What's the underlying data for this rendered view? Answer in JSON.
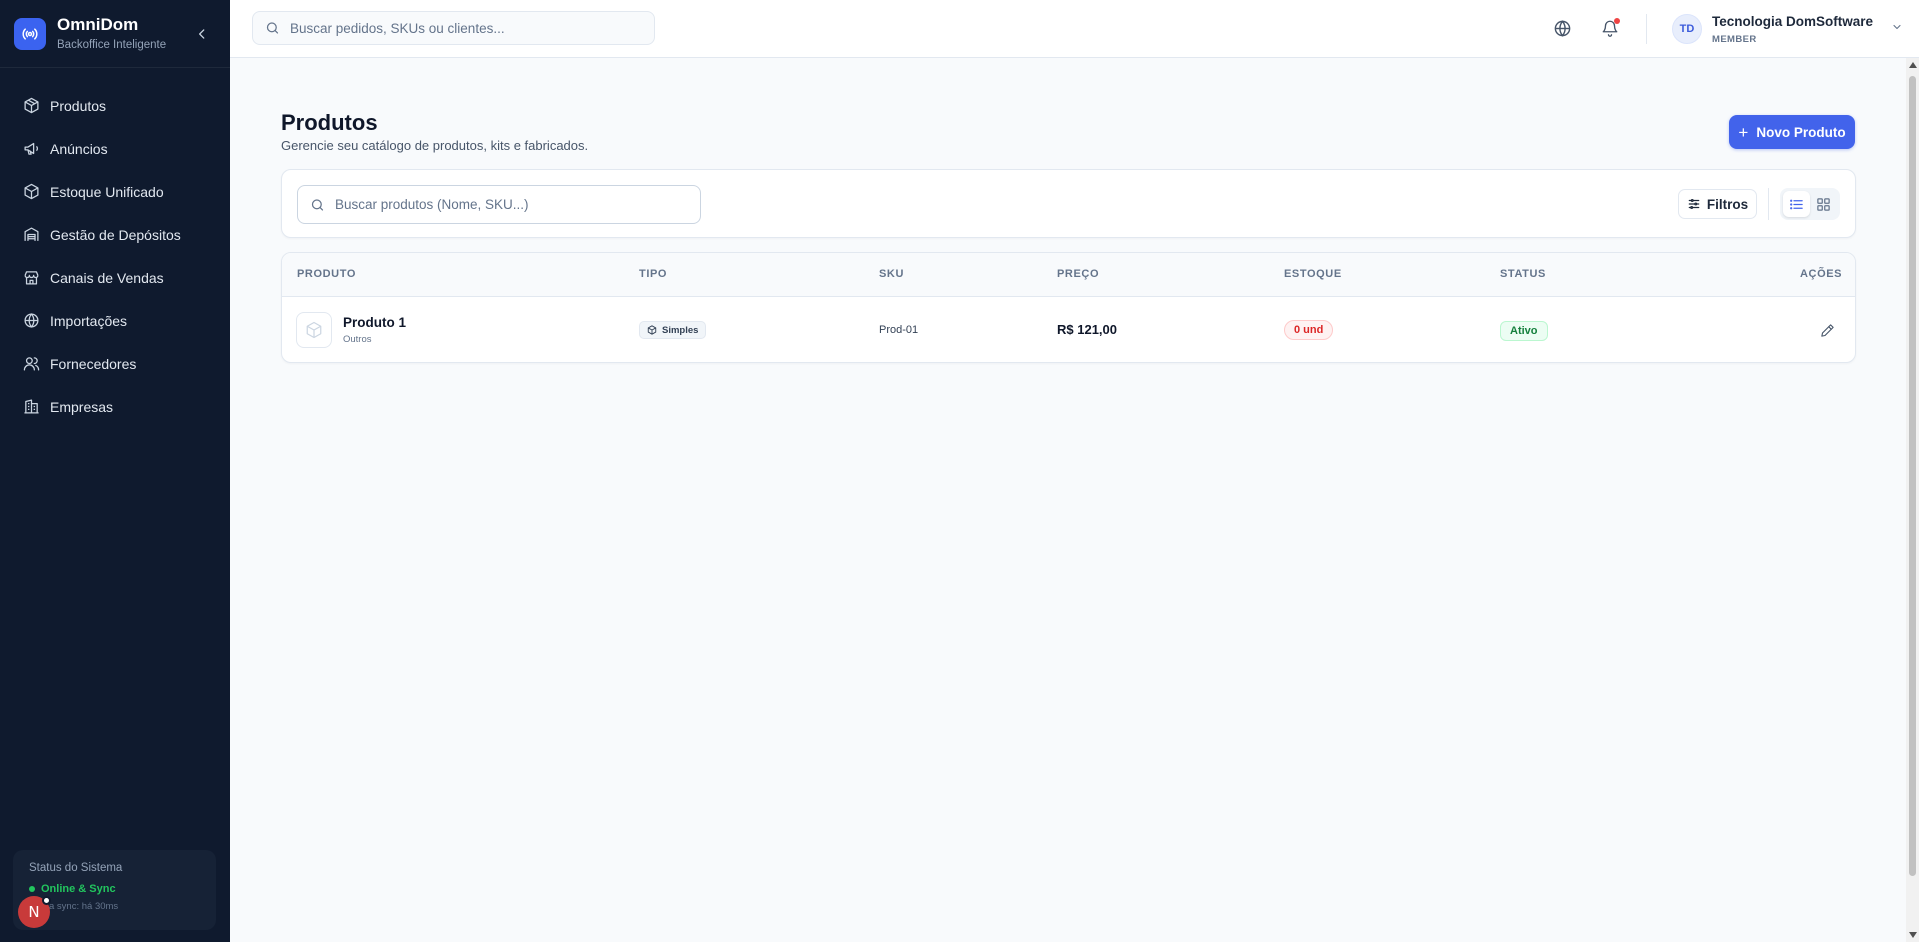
{
  "brand": {
    "name": "OmniDom",
    "subtitle": "Backoffice Inteligente",
    "icon": "broadcast-icon"
  },
  "sidebar": {
    "items": [
      {
        "label": "Produtos",
        "icon": "package-icon"
      },
      {
        "label": "Anúncios",
        "icon": "megaphone-icon"
      },
      {
        "label": "Estoque Unificado",
        "icon": "box-icon"
      },
      {
        "label": "Gestão de Depósitos",
        "icon": "warehouse-icon"
      },
      {
        "label": "Canais de Vendas",
        "icon": "store-icon"
      },
      {
        "label": "Importações",
        "icon": "globe-icon"
      },
      {
        "label": "Fornecedores",
        "icon": "users-icon"
      },
      {
        "label": "Empresas",
        "icon": "building-icon"
      }
    ],
    "status": {
      "title": "Status do Sistema",
      "state": "Online & Sync",
      "last_sync": "a sync: há 30ms"
    },
    "avatar_letter": "N"
  },
  "topbar": {
    "search_placeholder": "Buscar pedidos, SKUs ou clientes...",
    "user": {
      "initials": "TD",
      "name": "Tecnologia DomSoftware",
      "role": "MEMBER"
    }
  },
  "page": {
    "title": "Produtos",
    "subtitle": "Gerencie seu catálogo de produtos, kits e fabricados.",
    "new_button": "Novo Produto",
    "search_placeholder": "Buscar produtos (Nome, SKU...)",
    "filters_button": "Filtros"
  },
  "table": {
    "headers": {
      "produto": "PRODUTO",
      "tipo": "TIPO",
      "sku": "SKU",
      "preco": "PREÇO",
      "estoque": "ESTOQUE",
      "status": "STATUS",
      "acoes": "AÇÕES"
    },
    "rows": [
      {
        "name": "Produto 1",
        "category": "Outros",
        "type": "Simples",
        "sku": "Prod-01",
        "price": "R$ 121,00",
        "stock": "0 und",
        "status": "Ativo"
      }
    ]
  },
  "colors": {
    "sidebar_bg": "#0f1a2e",
    "accent": "#4263eb",
    "stock_alert": "#dc2626",
    "status_active": "#15803d",
    "online": "#22c55e"
  }
}
